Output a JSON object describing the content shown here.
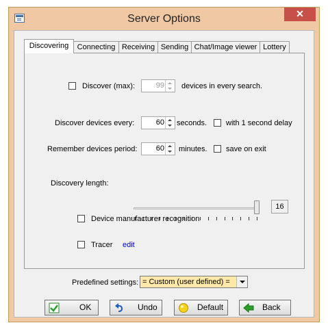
{
  "window": {
    "title": "Server Options",
    "close_glyph": "✕"
  },
  "tabs": [
    {
      "label": "Discovering"
    },
    {
      "label": "Connecting"
    },
    {
      "label": "Receiving"
    },
    {
      "label": "Sending"
    },
    {
      "label": "Chat/Image viewer"
    },
    {
      "label": "Lottery"
    }
  ],
  "discovering": {
    "discover_max": {
      "label": "Discover (max):",
      "value": "99",
      "suffix": "devices in every search.",
      "checked": false
    },
    "discover_every": {
      "label": "Discover devices every:",
      "value": "60",
      "unit": "seconds.",
      "delay_label": "with 1 second delay",
      "delay_checked": false
    },
    "remember": {
      "label": "Remember devices period:",
      "value": "60",
      "unit": "minutes.",
      "save_label": "save on exit",
      "save_checked": false
    },
    "discovery_length": {
      "label": "Discovery length:",
      "value": "16",
      "min": 1,
      "max": 16
    },
    "manufacturer": {
      "label": "Device manufacturer recognition",
      "checked": false
    },
    "tracer": {
      "label": "Tracer",
      "checked": false,
      "edit_link": "edit"
    }
  },
  "predefined": {
    "label": "Predefined settings:",
    "value": "= Custom (user defined) ="
  },
  "buttons": {
    "ok": {
      "label": "OK",
      "icon": "check-icon"
    },
    "undo": {
      "label": "Undo",
      "icon": "undo-icon"
    },
    "default": {
      "label": "Default",
      "icon": "default-icon"
    },
    "back": {
      "label": "Back",
      "icon": "back-arrow-icon"
    }
  },
  "colors": {
    "frame": "#f0c9a4",
    "close": "#c7504b",
    "combo": "#ffe8a8",
    "link": "#0000cc"
  }
}
